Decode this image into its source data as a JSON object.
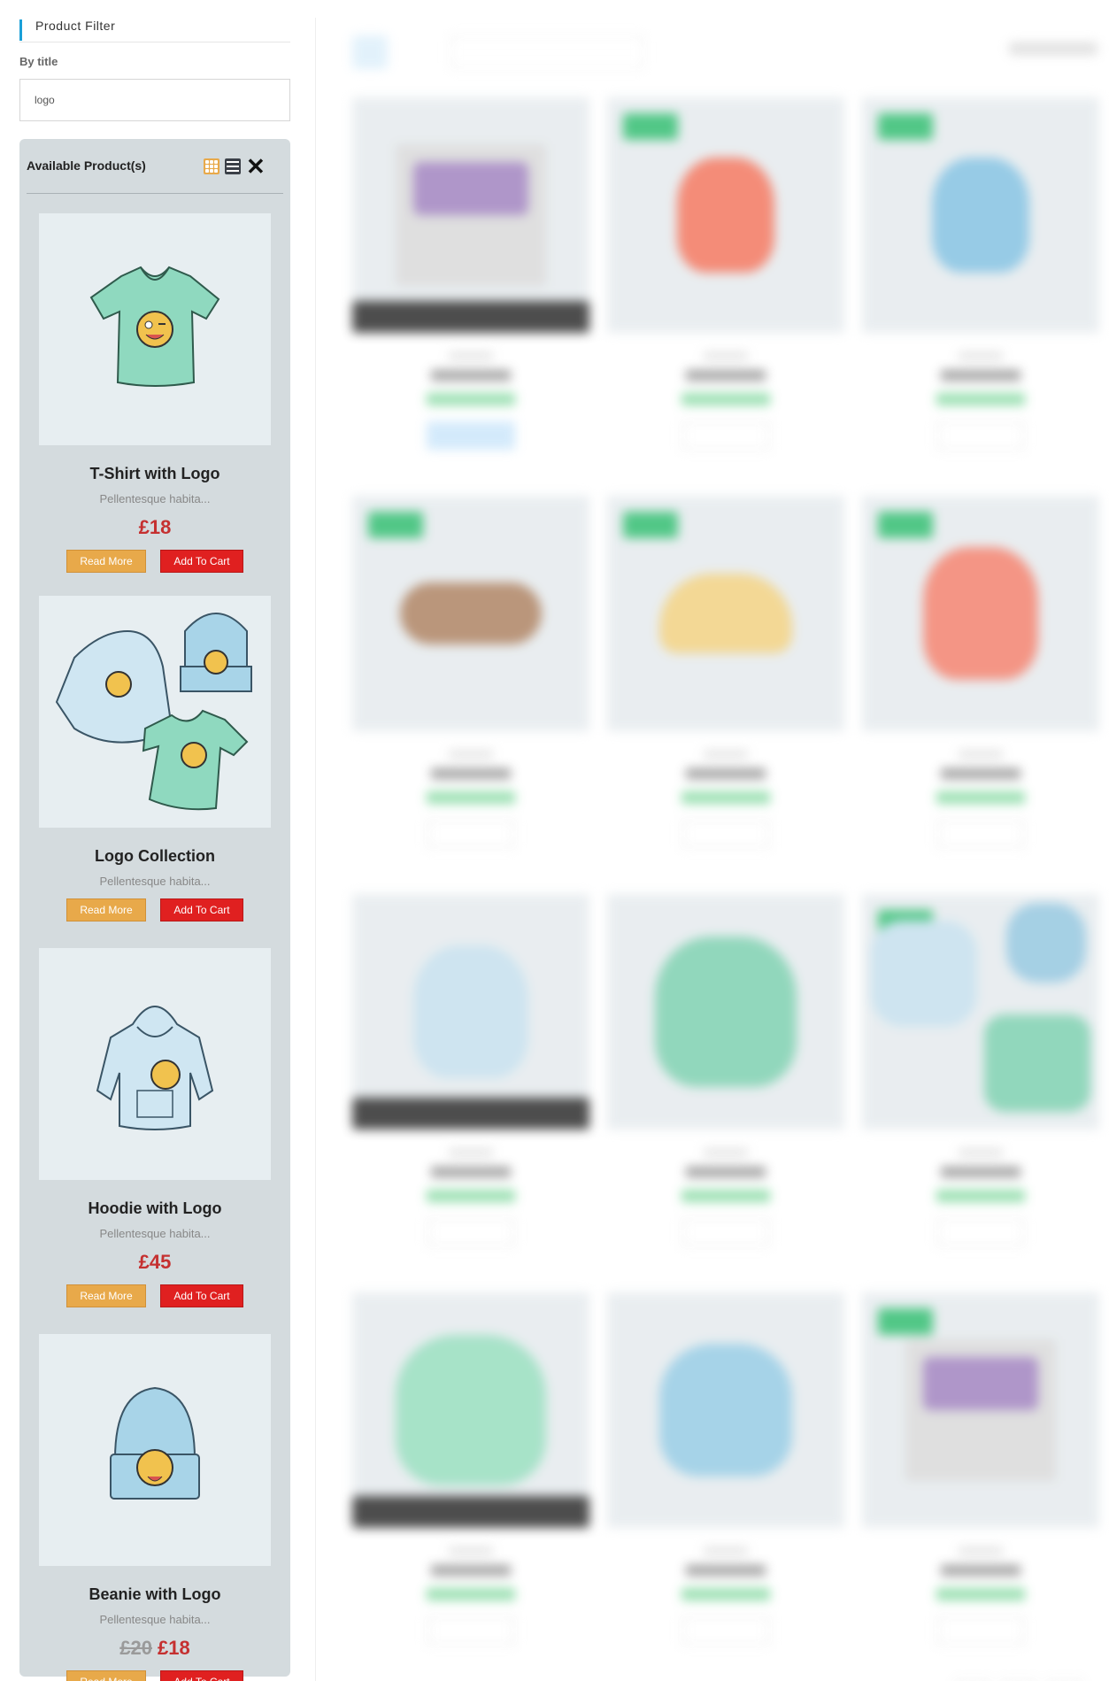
{
  "filter": {
    "title": "Product Filter",
    "by_title_label": "By title",
    "search_value": "logo"
  },
  "results": {
    "title": "Available Product(s)",
    "view_icons": [
      "grid-view-icon",
      "list-view-icon",
      "close-icon"
    ]
  },
  "products": [
    {
      "name": "T-Shirt with Logo",
      "desc": "Pellentesque habita...",
      "price": "£18",
      "old_price": "",
      "read_more": "Read More",
      "add_to_cart": "Add To Cart",
      "image": "tshirt"
    },
    {
      "name": "Logo Collection",
      "desc": "Pellentesque habita...",
      "price": "",
      "old_price": "",
      "read_more": "Read More",
      "add_to_cart": "Add To Cart",
      "image": "collection"
    },
    {
      "name": "Hoodie with Logo",
      "desc": "Pellentesque habita...",
      "price": "£45",
      "old_price": "",
      "read_more": "Read More",
      "add_to_cart": "Add To Cart",
      "image": "hoodie"
    },
    {
      "name": "Beanie with Logo",
      "desc": "Pellentesque habita...",
      "price": "£18",
      "old_price": "£20",
      "read_more": "Read More",
      "add_to_cart": "Add To Cart",
      "image": "beanie"
    }
  ],
  "colors": {
    "accent_blue": "#1aa0d8",
    "read_more_btn": "#e8a94a",
    "add_to_cart_btn": "#e02020",
    "price_red": "#c53030",
    "panel_bg": "#d4dbde",
    "shirt_green": "#8fd9bf",
    "beanie_blue": "#a8d4e8",
    "hoodie_lightblue": "#cfe6f2"
  }
}
